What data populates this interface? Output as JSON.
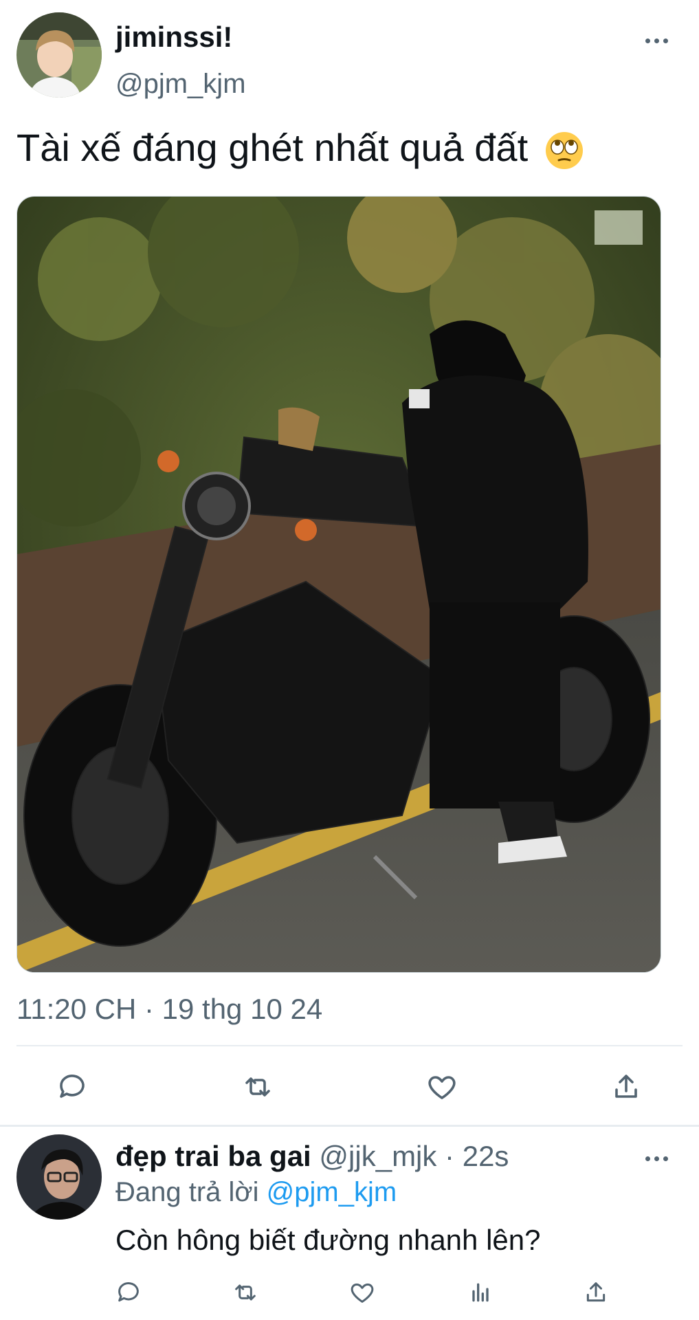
{
  "tweet": {
    "display_name": "jiminssi!",
    "handle": "@pjm_kjm",
    "text": "Tài xế đáng ghét nhất quả đất",
    "emoji_icon": "face-with-rolling-eyes-icon",
    "timestamp": "11:20 CH · 19 thg 10 24",
    "actions": [
      "reply-icon",
      "retweet-icon",
      "like-icon",
      "share-icon"
    ]
  },
  "reply": {
    "display_name": "đẹp trai ba gai",
    "meta": "@jjk_mjk · 22s",
    "replying_prefix": "Đang trả lời",
    "replying_to": "@pjm_kjm",
    "text": "Còn hông biết đường nhanh lên?",
    "actions": [
      "reply-icon",
      "retweet-icon",
      "like-icon",
      "analytics-icon",
      "share-icon"
    ]
  },
  "colors": {
    "text": "#0f1419",
    "secondary": "#536471",
    "link": "#1d9bf0",
    "divider": "#e7ecf0"
  }
}
